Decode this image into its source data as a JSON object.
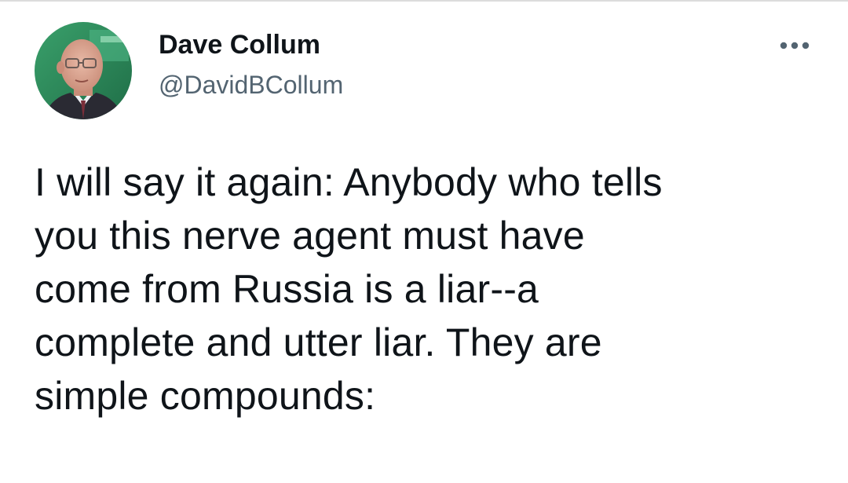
{
  "tweet": {
    "author": {
      "display_name": "Dave Collum",
      "handle": "@DavidBCollum"
    },
    "more_icon": "more-horizontal-icon",
    "text": "I will say it again: Anybody who tells\nyou this nerve agent must have\ncome from Russia is a liar--a\ncomplete and utter liar. They are\nsimple compounds:"
  },
  "colors": {
    "text_primary": "#0f1419",
    "text_secondary": "#536471",
    "divider": "#dcdcdc",
    "avatar_background": "#2e8a5c"
  }
}
